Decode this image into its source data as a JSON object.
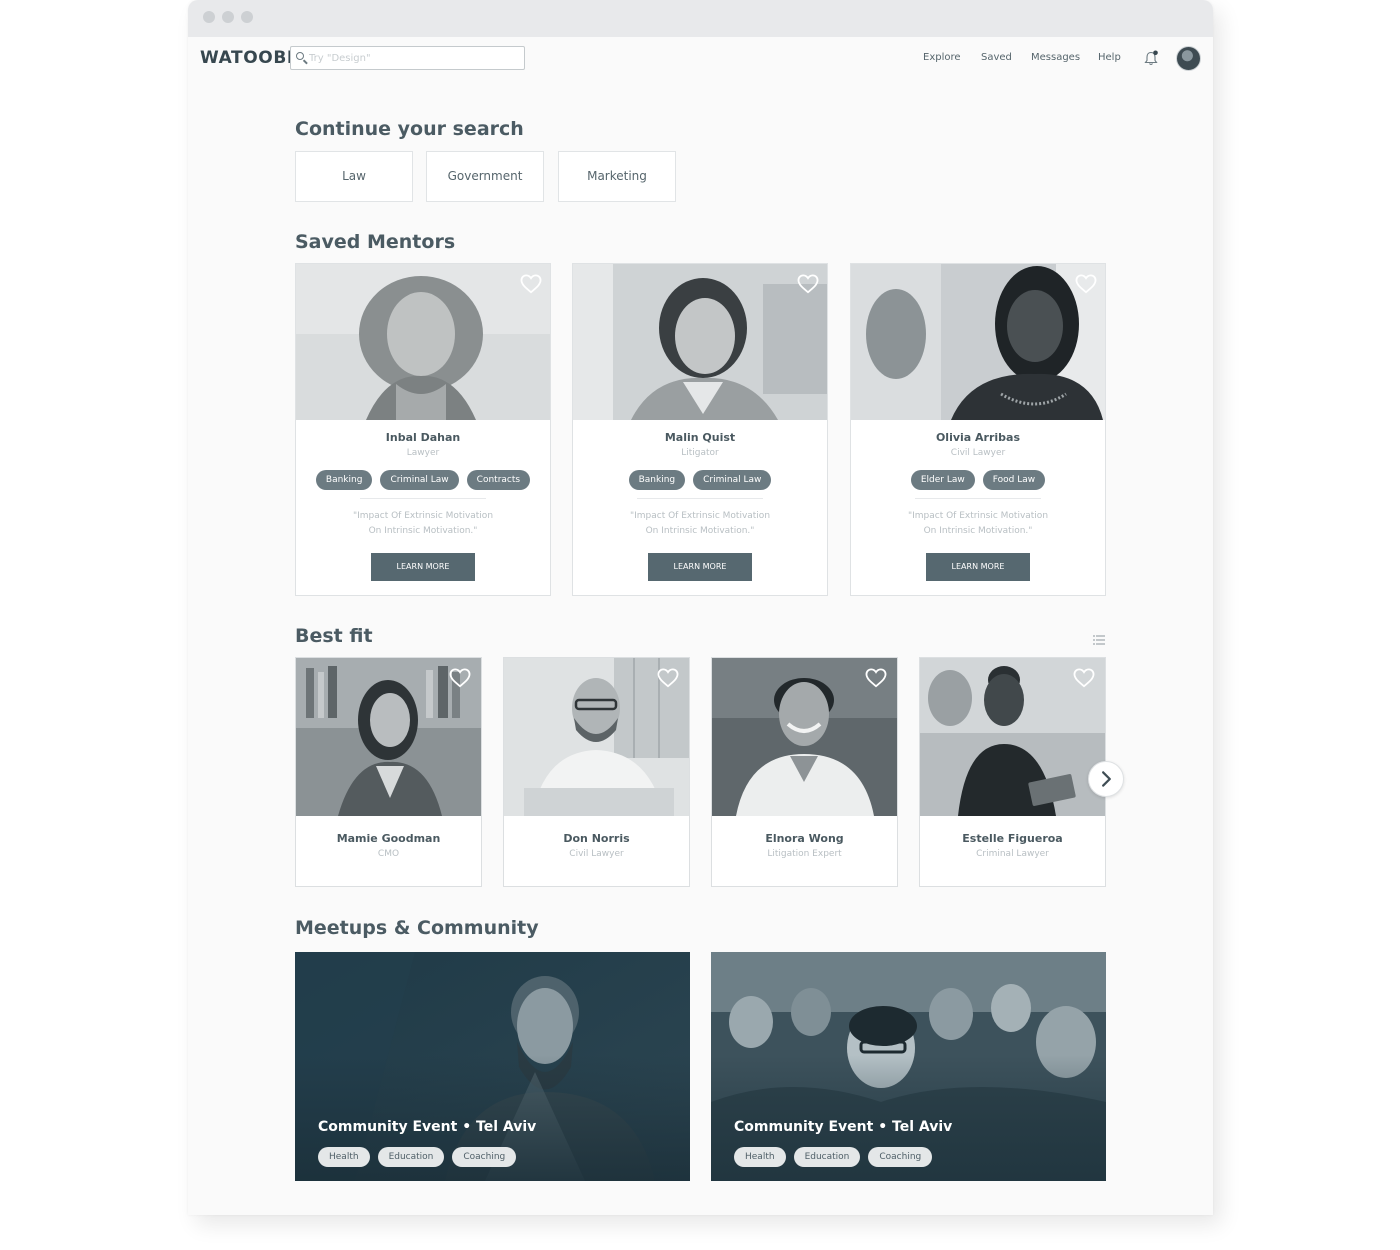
{
  "app": {
    "logo": "WATOOBI"
  },
  "search": {
    "placeholder": "Try \"Design\""
  },
  "nav": {
    "items": [
      "Explore",
      "Saved",
      "Messages",
      "Help"
    ]
  },
  "continue_search": {
    "title": "Continue your search",
    "chips": [
      "Law",
      "Government",
      "Marketing"
    ]
  },
  "saved_mentors": {
    "title": "Saved Mentors",
    "cards": [
      {
        "name": "Inbal Dahan",
        "role": "Lawyer",
        "tags": [
          "Banking",
          "Criminal Law",
          "Contracts"
        ],
        "quote_line1": "\"Impact Of Extrinsic Motivation",
        "quote_line2": "On Intrinsic Motivation.\"",
        "button": "LEARN MORE"
      },
      {
        "name": "Malin Quist",
        "role": "Litigator",
        "tags": [
          "Banking",
          "Criminal Law"
        ],
        "quote_line1": "\"Impact Of Extrinsic Motivation",
        "quote_line2": "On Intrinsic Motivation.\"",
        "button": "LEARN MORE"
      },
      {
        "name": "Olivia Arribas",
        "role": "Civil Lawyer",
        "tags": [
          "Elder Law",
          "Food Law"
        ],
        "quote_line1": "\"Impact Of Extrinsic Motivation",
        "quote_line2": "On Intrinsic Motivation.\"",
        "button": "LEARN MORE"
      }
    ]
  },
  "best_fit": {
    "title": "Best fit",
    "cards": [
      {
        "name": "Mamie Goodman",
        "role": "CMO"
      },
      {
        "name": "Don Norris",
        "role": "Civil Lawyer"
      },
      {
        "name": "Elnora Wong",
        "role": "Litigation Expert"
      },
      {
        "name": "Estelle Figueroa",
        "role": "Criminal Lawyer"
      }
    ]
  },
  "meetups": {
    "title": "Meetups & Community",
    "events": [
      {
        "title": "Community Event • Tel Aviv",
        "tags": [
          "Health",
          "Education",
          "Coaching"
        ]
      },
      {
        "title": "Community Event • Tel Aviv",
        "tags": [
          "Health",
          "Education",
          "Coaching"
        ]
      }
    ]
  },
  "colors": {
    "accent": "#566870",
    "tag": "#6c7b82",
    "text": "#4b5b63",
    "muted": "#b8bfc3"
  },
  "icons": [
    "search-icon",
    "bell-icon",
    "heart-icon",
    "chevron-right-icon",
    "list-view-icon"
  ]
}
